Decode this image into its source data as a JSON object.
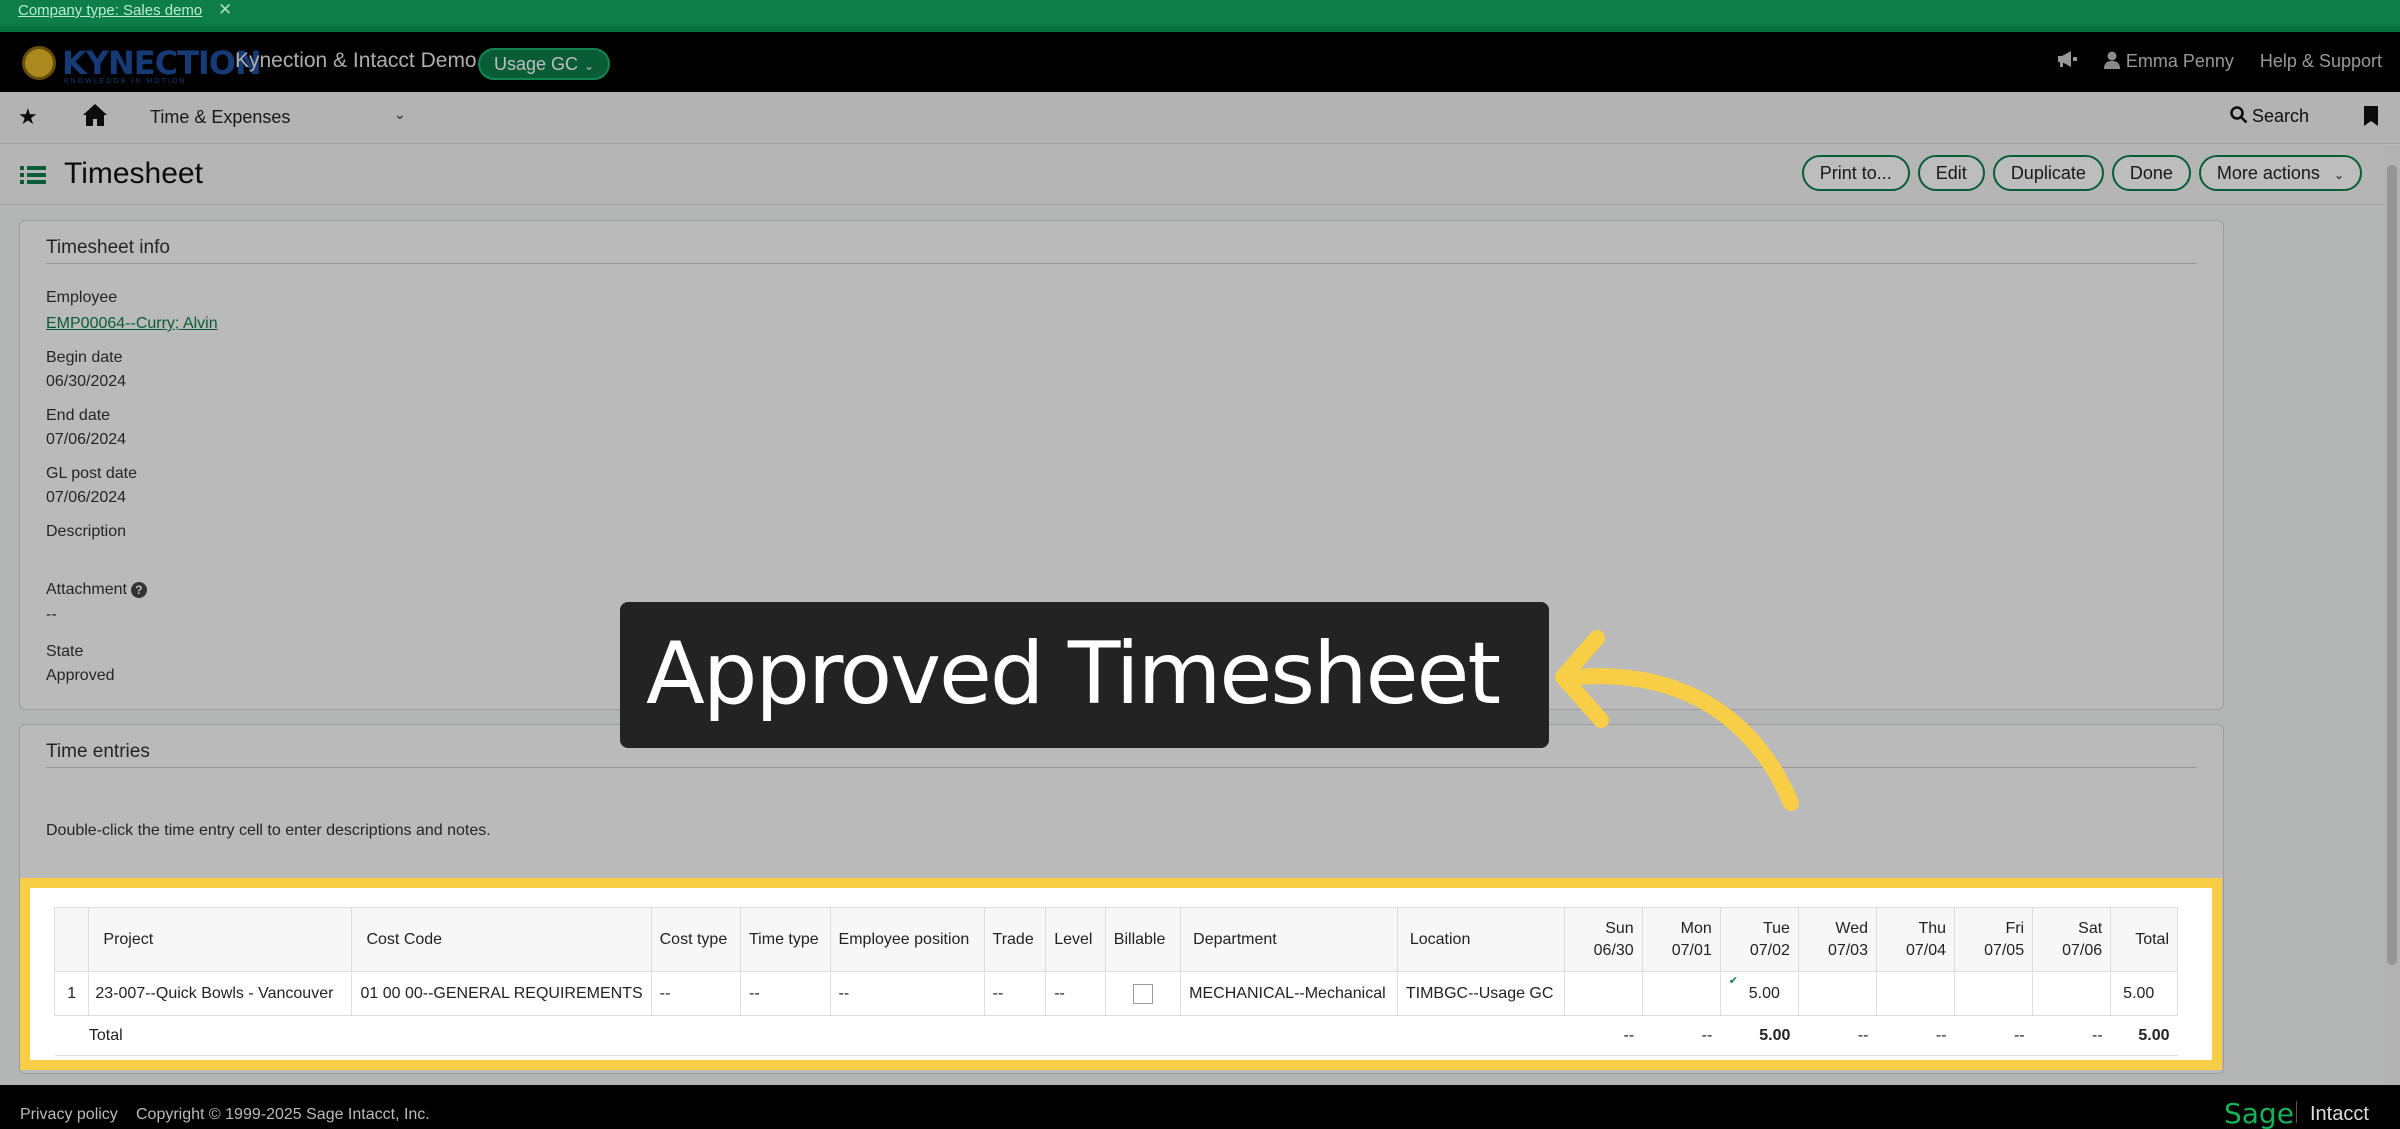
{
  "banner": {
    "company_type": "Company type: Sales demo",
    "close": "✕"
  },
  "header": {
    "logo_text": "KYNECTION",
    "logo_tagline": "KNOWLEDGE IN MOTION",
    "company": "Kynection & Intacct Demo",
    "entity": "Usage GC",
    "user": "Emma Penny",
    "help": "Help & Support"
  },
  "nav": {
    "module": "Time & Expenses",
    "search": "Search"
  },
  "page": {
    "title": "Timesheet",
    "actions": [
      "Print to...",
      "Edit",
      "Duplicate",
      "Done",
      "More actions"
    ]
  },
  "info": {
    "section_title": "Timesheet info",
    "employee_label": "Employee",
    "employee_value": "EMP00064--Curry; Alvin",
    "begin_label": "Begin date",
    "begin_value": "06/30/2024",
    "end_label": "End date",
    "end_value": "07/06/2024",
    "gl_label": "GL post date",
    "gl_value": "07/06/2024",
    "description_label": "Description",
    "attachment_label": "Attachment",
    "attachment_value": "--",
    "state_label": "State",
    "state_value": "Approved"
  },
  "entries": {
    "section_title": "Time entries",
    "hint": "Double-click the time entry cell to enter descriptions and notes.",
    "headers": {
      "project": "Project",
      "cost_code": "Cost Code",
      "cost_type": "Cost type",
      "time_type": "Time type",
      "employee_position": "Employee position",
      "trade": "Trade",
      "level": "Level",
      "billable": "Billable",
      "department": "Department",
      "location": "Location",
      "sun": "Sun",
      "sun_date": "06/30",
      "mon": "Mon",
      "mon_date": "07/01",
      "tue": "Tue",
      "tue_date": "07/02",
      "wed": "Wed",
      "wed_date": "07/03",
      "thu": "Thu",
      "thu_date": "07/04",
      "fri": "Fri",
      "fri_date": "07/05",
      "sat": "Sat",
      "sat_date": "07/06",
      "total": "Total"
    },
    "row": {
      "num": "1",
      "project": "23-007--Quick Bowls - Vancouver",
      "cost_code": "01 00 00--GENERAL REQUIREMENTS",
      "cost_type": "--",
      "time_type": "--",
      "employee_position": "--",
      "trade": "--",
      "level": "--",
      "billable": false,
      "department": "MECHANICAL--Mechanical",
      "location": "TIMBGC--Usage GC",
      "sun": "",
      "mon": "",
      "tue": "5.00",
      "wed": "",
      "thu": "",
      "fri": "",
      "sat": "",
      "total": "5.00"
    },
    "totals": {
      "label": "Total",
      "sun": "--",
      "mon": "--",
      "tue": "5.00",
      "wed": "--",
      "thu": "--",
      "fri": "--",
      "sat": "--",
      "total": "5.00"
    }
  },
  "callout": {
    "text": "Approved Timesheet"
  },
  "footer": {
    "privacy": "Privacy policy",
    "copyright": "Copyright © 1999-2025 Sage Intacct, Inc.",
    "sage": "Sage",
    "intacct": "Intacct"
  },
  "colors": {
    "brand_green": "#0d7e4a",
    "highlight_yellow": "#f7ce45",
    "callout_bg": "#232323"
  }
}
